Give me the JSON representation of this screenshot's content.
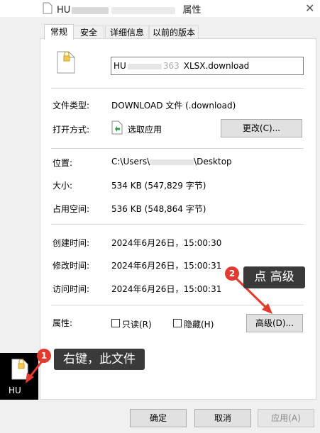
{
  "window": {
    "title_prefix": "HU",
    "title_suffix": "属性",
    "close_glyph": "✕"
  },
  "tabs": [
    {
      "label": "常规",
      "active": true
    },
    {
      "label": "安全",
      "active": false
    },
    {
      "label": "详细信息",
      "active": false
    },
    {
      "label": "以前的版本",
      "active": false
    }
  ],
  "file": {
    "name_prefix": "HU",
    "name_middle": "363",
    "name_suffix": "XLSX.download",
    "type_label": "文件类型:",
    "type_value": "DOWNLOAD 文件 (.download)",
    "open_with_label": "打开方式:",
    "open_with_value": "选取应用",
    "change_button": "更改(C)...",
    "location_label": "位置:",
    "location_prefix": "C:\\Users\\",
    "location_suffix": "\\Desktop",
    "size_label": "大小:",
    "size_value": "534 KB (547,829 字节)",
    "disk_label": "占用空间:",
    "disk_value": "536 KB (548,864 字节)",
    "created_label": "创建时间:",
    "created_value": "2024年6月26日，15:00:30",
    "modified_label": "修改时间:",
    "modified_value": "2024年6月26日，15:00:31",
    "accessed_label": "访问时间:",
    "accessed_value": "2024年6月26日，15:00:31",
    "attributes_label": "属性:",
    "readonly_label": "只读(R)",
    "hidden_label": "隐藏(H)",
    "advanced_button": "高级(D)..."
  },
  "footer": {
    "ok": "确定",
    "cancel": "取消",
    "apply": "应用(A)"
  },
  "annotations": {
    "step1_number": "1",
    "step1_text": "右键，此文件",
    "step2_number": "2",
    "step2_text": "点 高级",
    "desktop_icon_label": "HU"
  },
  "colors": {
    "accent_red": "#e33a2f",
    "callout_bg": "#3a3a3a",
    "dialog_bg": "#f0f0f0"
  }
}
